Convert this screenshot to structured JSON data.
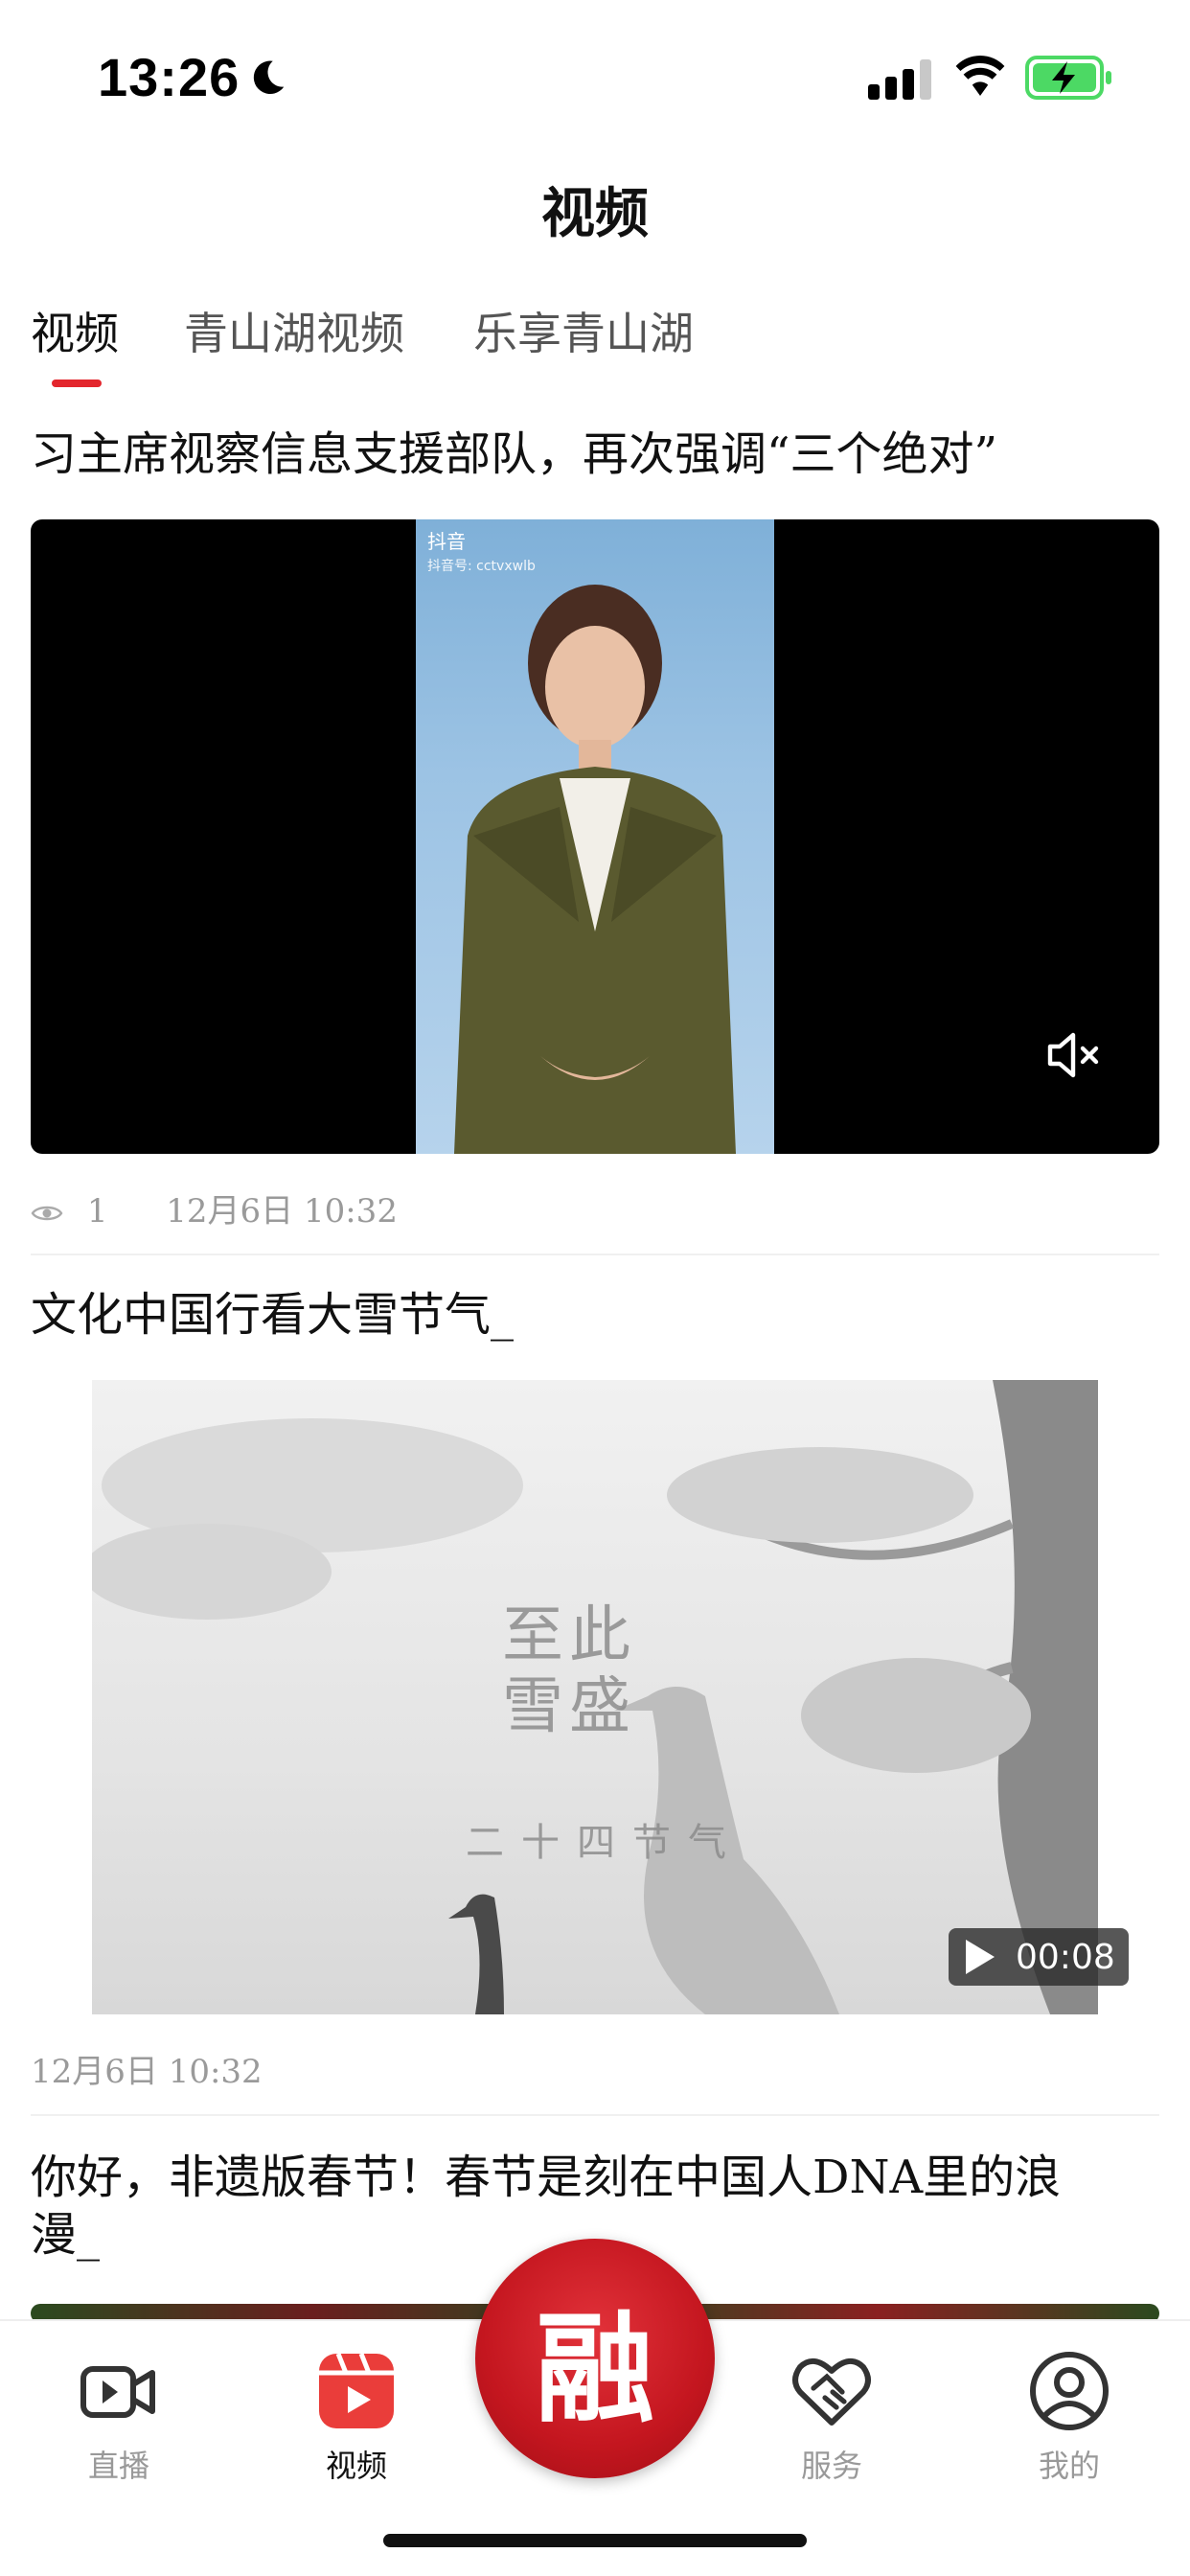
{
  "status_bar": {
    "time": "13:26"
  },
  "header": {
    "title": "视频"
  },
  "tabs": [
    {
      "label": "视频",
      "active": true
    },
    {
      "label": "青山湖视频",
      "active": false
    },
    {
      "label": "乐享青山湖",
      "active": false
    }
  ],
  "feed": {
    "items": [
      {
        "title": "习主席视察信息支援部队，再次强调“三个绝对”",
        "video_watermark": {
          "brand": "抖音",
          "account": "抖音号: cctvxwlb"
        },
        "views": "1",
        "timestamp": "12月6日  10:32"
      },
      {
        "title": "文化中国行看大雪节气_",
        "overlay_text": {
          "line1": "至此",
          "line2": "雪盛",
          "caption": "二十四节气"
        },
        "duration": "00:08",
        "timestamp": "12月6日  10:32"
      },
      {
        "title": "你好，非遗版春节！春节是刻在中国人DNA里的浪漫_"
      }
    ]
  },
  "bottom_nav": {
    "items": [
      {
        "label": "直播",
        "icon": "video-camera-icon"
      },
      {
        "label": "视频",
        "icon": "video-play-icon",
        "active": true
      },
      {
        "label": "",
        "icon": "rong-logo",
        "center_glyph": "融"
      },
      {
        "label": "服务",
        "icon": "handshake-heart-icon"
      },
      {
        "label": "我的",
        "icon": "user-profile-icon"
      }
    ]
  },
  "colors": {
    "accent_red": "#e3262d",
    "muted_text": "#9a9a9a"
  }
}
